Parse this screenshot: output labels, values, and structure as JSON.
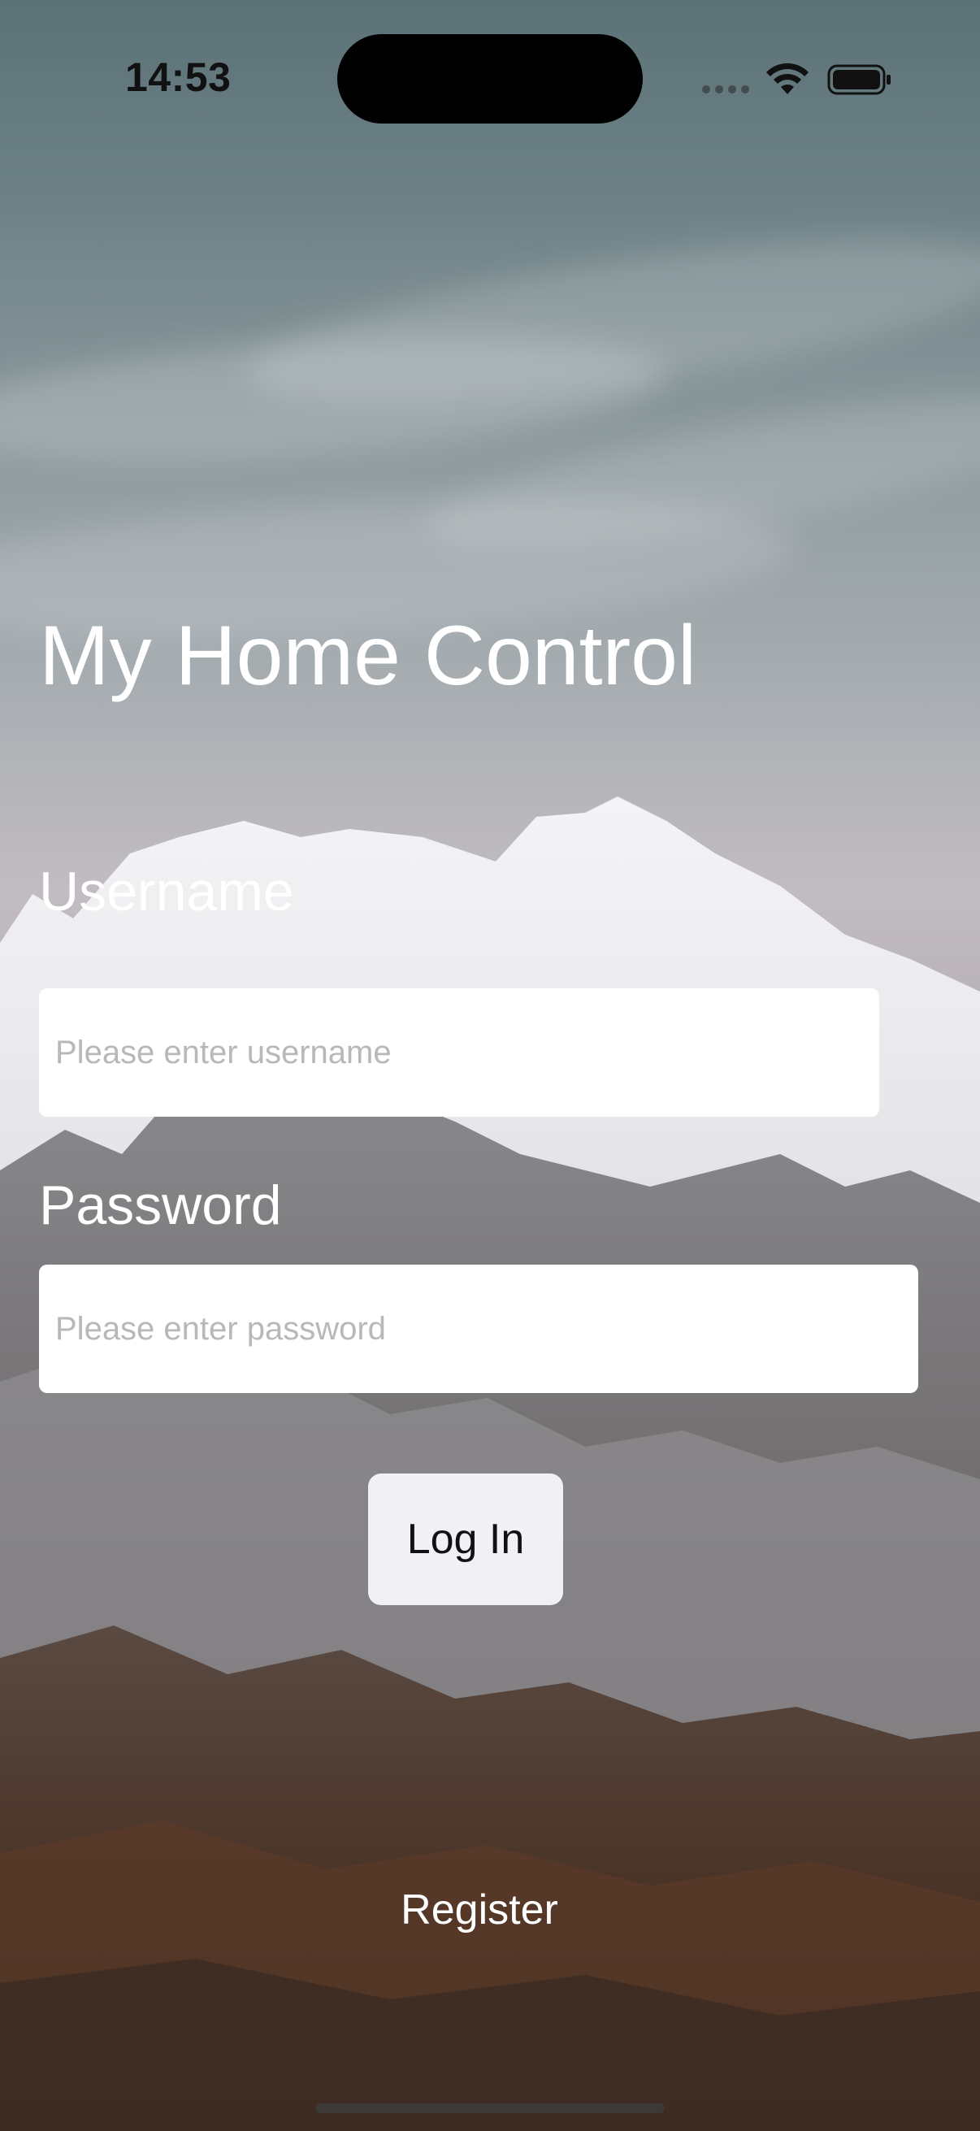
{
  "status_bar": {
    "time": "14:53",
    "icons": [
      "signal-dots-icon",
      "wifi-icon",
      "battery-icon"
    ]
  },
  "app": {
    "title": "My Home Control"
  },
  "form": {
    "username_label": "Username",
    "username_placeholder": "Please enter username",
    "username_value": "",
    "password_label": "Password",
    "password_placeholder": "Please enter password",
    "password_value": "",
    "login_label": "Log In",
    "register_label": "Register"
  },
  "colors": {
    "text_primary": "#ffffff",
    "input_background": "#ffffff",
    "placeholder": "#b8b8bb",
    "button_background": "#f1f1f5"
  }
}
